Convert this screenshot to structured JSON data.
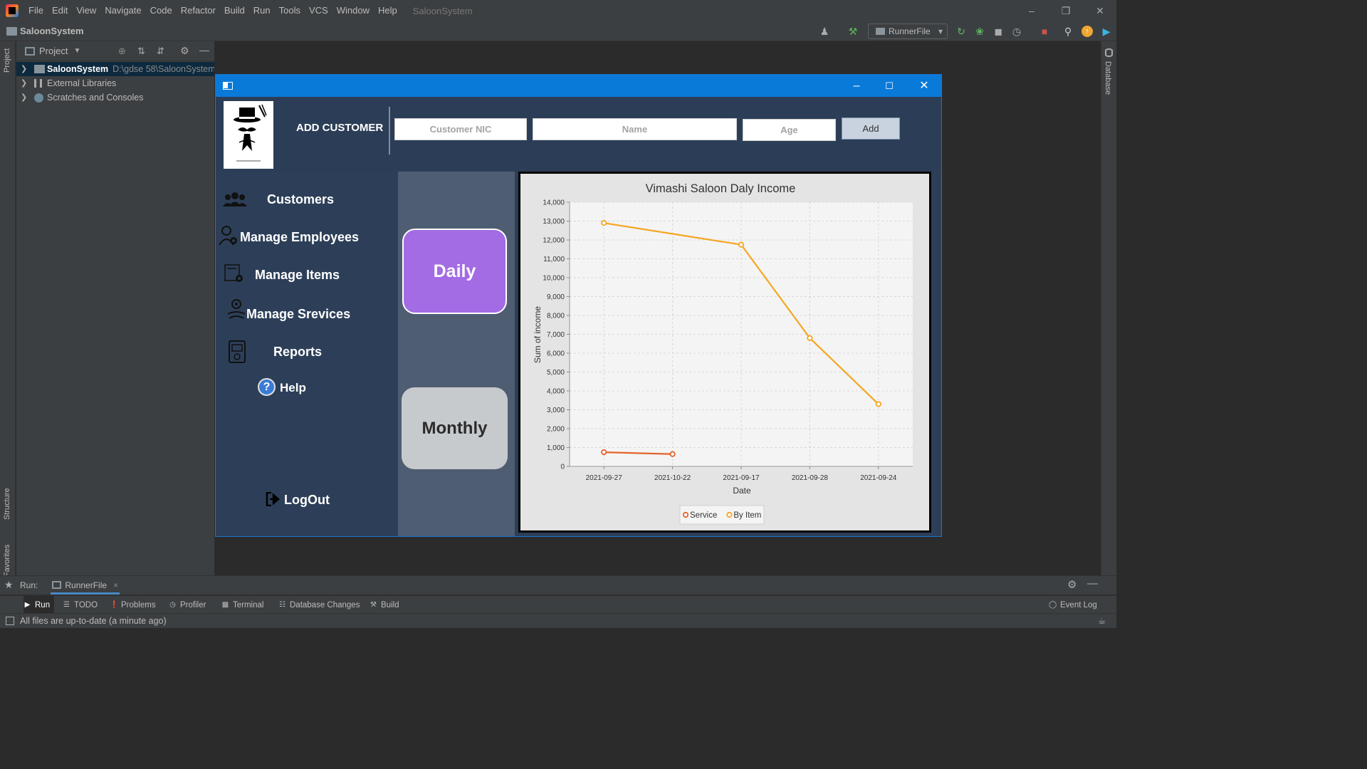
{
  "ide": {
    "menu": [
      "File",
      "Edit",
      "View",
      "Navigate",
      "Code",
      "Refactor",
      "Build",
      "Run",
      "Tools",
      "VCS",
      "Window",
      "Help"
    ],
    "project_title": "SaloonSystem",
    "breadcrumb": "SaloonSystem",
    "run_config": "RunnerFile",
    "project_panel_title": "Project",
    "tree": {
      "root_name": "SaloonSystem",
      "root_path": "D:\\gdse 58\\SaloonSystem",
      "external_libraries": "External Libraries",
      "scratches": "Scratches and Consoles"
    },
    "left_strip": {
      "project": "Project",
      "structure": "Structure",
      "favorites": "Favorites"
    },
    "right_strip": {
      "database": "Database"
    },
    "run_bar": {
      "label": "Run:",
      "tab": "RunnerFile"
    },
    "tool_windows": [
      "Run",
      "TODO",
      "Problems",
      "Profiler",
      "Terminal",
      "Database Changes",
      "Build"
    ],
    "event_log": "Event Log",
    "status": "All files are up-to-date (a minute ago)"
  },
  "app": {
    "header": {
      "title": "ADD CUSTOMER",
      "nic_placeholder": "Customer NIC",
      "name_placeholder": "Name",
      "age_placeholder": "Age",
      "add_label": "Add"
    },
    "nav": {
      "customers": "Customers",
      "employees": "Manage Employees",
      "items": "Manage Items",
      "services": "Manage Srevices",
      "reports": "Reports",
      "help": "Help",
      "logout": "LogOut"
    },
    "buttons": {
      "daily": "Daily",
      "monthly": "Monthly"
    }
  },
  "colors": {
    "service_series": "#e5632b",
    "byitem_series": "#f5a623",
    "daily_button": "#a36be4",
    "titlebar": "#0a7ad9"
  },
  "chart_data": {
    "type": "line",
    "title": "Vimashi Saloon Daly Income",
    "xlabel": "Date",
    "ylabel": "Sum of income",
    "categories": [
      "2021-09-27",
      "2021-10-22",
      "2021-09-17",
      "2021-09-28",
      "2021-09-24"
    ],
    "ylim": [
      0,
      14000
    ],
    "yticks": [
      0,
      1000,
      2000,
      3000,
      4000,
      5000,
      6000,
      7000,
      8000,
      9000,
      10000,
      11000,
      12000,
      13000,
      14000
    ],
    "ytick_labels": [
      "0",
      "1,000",
      "2,000",
      "3,000",
      "4,000",
      "5,000",
      "6,000",
      "7,000",
      "8,000",
      "9,000",
      "10,000",
      "11,000",
      "12,000",
      "13,000",
      "14,000"
    ],
    "grid": true,
    "legend_position": "bottom",
    "series": [
      {
        "name": "Service",
        "values": [
          750,
          650,
          null,
          null,
          null
        ]
      },
      {
        "name": "By Item",
        "values": [
          12900,
          null,
          11750,
          6800,
          3300
        ]
      }
    ]
  }
}
